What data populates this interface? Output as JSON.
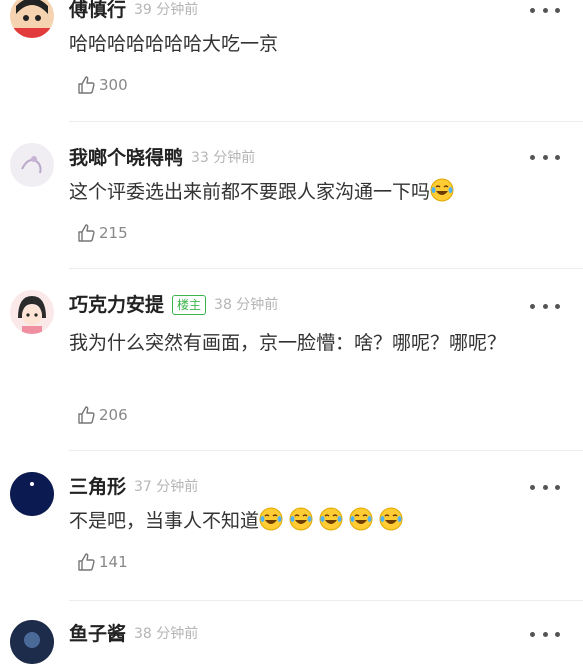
{
  "comments": [
    {
      "name": "傅慎行",
      "time": "39 分钟前",
      "text": "哈哈哈哈哈哈哈大吃一京",
      "likes": "300",
      "emoji_count": 0
    },
    {
      "name": "我啷个晓得鸭",
      "time": "33 分钟前",
      "text": "这个评委选出来前都不要跟人家沟通一下吗",
      "likes": "215",
      "emoji_count": 1
    },
    {
      "name": "巧克力安提",
      "badge": "楼主",
      "time": "38 分钟前",
      "text": "我为什么突然有画面，京一脸懵：啥？哪呢？哪呢？",
      "likes": "206",
      "emoji_count": 0
    },
    {
      "name": "三角形",
      "time": "37 分钟前",
      "text": "不是吧，当事人不知道",
      "likes": "141",
      "emoji_count": 5
    },
    {
      "name": "鱼子酱",
      "time": "38 分钟前"
    }
  ],
  "icons": {
    "like": "thumbs-up-icon",
    "more": "more-dots-icon",
    "emoji": "laughing-tears-emoji-icon"
  },
  "colors": {
    "badge": "#3bb54a",
    "time": "#b5b5b5",
    "name": "#222222"
  }
}
